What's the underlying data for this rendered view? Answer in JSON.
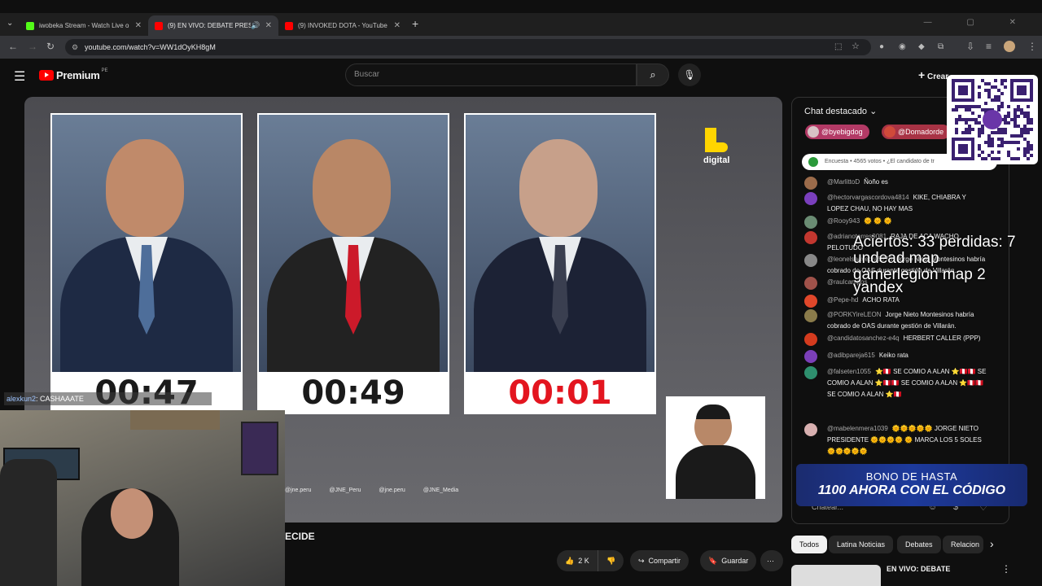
{
  "browser": {
    "tabs": [
      {
        "title": "iwobeka Stream - Watch Live o",
        "color": "#53fc18"
      },
      {
        "title": "(9) EN VIVO: DEBATE PRESI",
        "color": "#ff0000"
      },
      {
        "title": "(9) INVOKED DOTA - YouTube",
        "color": "#ff0000"
      }
    ],
    "new_tab": "+",
    "url": "youtube.com/watch?v=WW1dOyKH8gM"
  },
  "youtube": {
    "brand": "Premium",
    "brand_sup": "PE",
    "search_placeholder": "Buscar",
    "create_label": "Crear",
    "notif_count": "9+"
  },
  "video": {
    "timers": [
      "00:47",
      "00:49",
      "00:01"
    ],
    "timer_colors": [
      "#1a1a1a",
      "#1a1a1a",
      "#e3151f"
    ],
    "channel_logo": "digital",
    "socials": [
      "@jne.peru",
      "@JNE_Peru",
      "@jne.peru",
      "@JNE_Media"
    ],
    "title_fragment": "ECIDE"
  },
  "webcam": {
    "caption_user": "alexkun2",
    "caption_text": ": CASHAAATE"
  },
  "actions": {
    "likes": "2 K",
    "share": "Compartir",
    "save": "Guardar"
  },
  "chat": {
    "header": "Chat destacado",
    "pinned": [
      "@byebigdog",
      "@Domadorde"
    ],
    "poll": "Encuesta • 4565 votos • ¿El candidato de tr",
    "messages": [
      {
        "author": "@MarlittoD",
        "text": "Ñoño es",
        "avatar": "#9b6b4a"
      },
      {
        "author": "@hectorvargascordova4814",
        "text": "KIKE, CHIABRA Y LOPEZ CHAU, NO HAY MAS",
        "avatar": "#7a3fbd"
      },
      {
        "author": "@Rooy943",
        "text": "🌞 🌞 🌞",
        "avatar": "#6a8c73"
      },
      {
        "author": "@adrianotorres9081",
        "text": "RAJA DE ACA WACHO PELOTUDO",
        "avatar": "#c2372f"
      },
      {
        "author": "@leonelsaavedra5775",
        "text": "Jorge Nieto Montesinos habría cobrado de OAS durante gestión de Villarán.",
        "avatar": "#888888"
      },
      {
        "author": "@raulcampos",
        "text": "",
        "avatar": "#a0524a"
      },
      {
        "author": "@Pepe-hd",
        "text": "ACHO RATA",
        "avatar": "#e0472a"
      },
      {
        "author": "@PORKYireLEON",
        "text": "Jorge Nieto Montesinos habría cobrado de OAS durante gestión de Villarán.",
        "avatar": "#8a7b4a"
      },
      {
        "author": "@candidatosanchez-e4q",
        "text": "HERBERT CALLER (PPP)",
        "avatar": "#d43b1e"
      },
      {
        "author": "@adibpareja615",
        "text": "Keiko rata",
        "avatar": "#7b3fb8"
      },
      {
        "author": "@falseten1055",
        "text": "⭐🇵🇪 SE COMIO A ALAN ⭐🇵🇪🇵🇪 SE COMIO A ALAN ⭐🇵🇪🇵🇪 SE COMIO A ALAN ⭐🇵🇪🇵🇪 SE COMIO A ALAN ⭐🇵🇪",
        "avatar": "#2e8f6e"
      },
      {
        "author": "@mabelenmera1039",
        "text": "🌞🌞🌞🌞🌞 JORGE NIETO PRESIDENTE 🌞🌞🌞🌞 🌞 MARCA LOS 5 SOLES 🌞🌞🌞🌞🌞",
        "avatar": "#d8b0b0"
      }
    ],
    "input_placeholder": "Chatear...",
    "ad_line1": "BONO DE HASTA",
    "ad_line2": "1100 AHORA CON EL CÓDIGO"
  },
  "overlay": {
    "line1": "Aciertos: 33 perdidas: 7",
    "line2": "undead map",
    "line3": "gamerlegion map 2",
    "line4": "yandex"
  },
  "chips": [
    "Todos",
    "Latina Noticias",
    "Debates",
    "Relacion"
  ],
  "recommendation": "EN VIVO: DEBATE"
}
